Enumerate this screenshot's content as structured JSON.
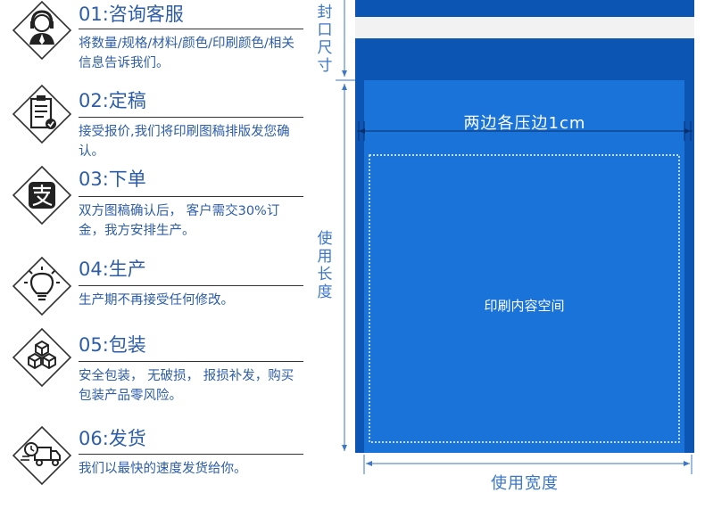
{
  "steps": [
    {
      "num": "01:咨询客服",
      "desc": "将数量/规格/材料/颜色/印刷颜色/相关信息告诉我们。",
      "icon": "customer-service-icon"
    },
    {
      "num": "02:定稿",
      "desc": "接受报价,我们将印刷图稿排版发您确认。",
      "icon": "clipboard-check-icon"
    },
    {
      "num": "03:下单",
      "desc": "双方图稿确认后， 客户需交30%订金，我方安排生产。",
      "icon": "alipay-icon"
    },
    {
      "num": "04:生产",
      "desc": "生产期不再接受任何修改。",
      "icon": "lightbulb-icon"
    },
    {
      "num": "05:包装",
      "desc": "安全包装， 无破损， 报损补发，购买包装产品零风险。",
      "icon": "boxes-icon"
    },
    {
      "num": "06:发货",
      "desc": "我们以最快的速度发货给你。",
      "icon": "delivery-truck-icon"
    }
  ],
  "diagram": {
    "seal_size_label": "封口尺寸",
    "usable_length_label": "使用长度",
    "usable_width_label": "使用宽度",
    "side_press_label": "两边各压边1cm",
    "print_area_label": "印刷内容空间",
    "colors": {
      "bag_dark": "#0d55b3",
      "bag_light": "#1a73d9",
      "accent": "#3b76c9",
      "text_blue": "#2d5da8"
    }
  }
}
